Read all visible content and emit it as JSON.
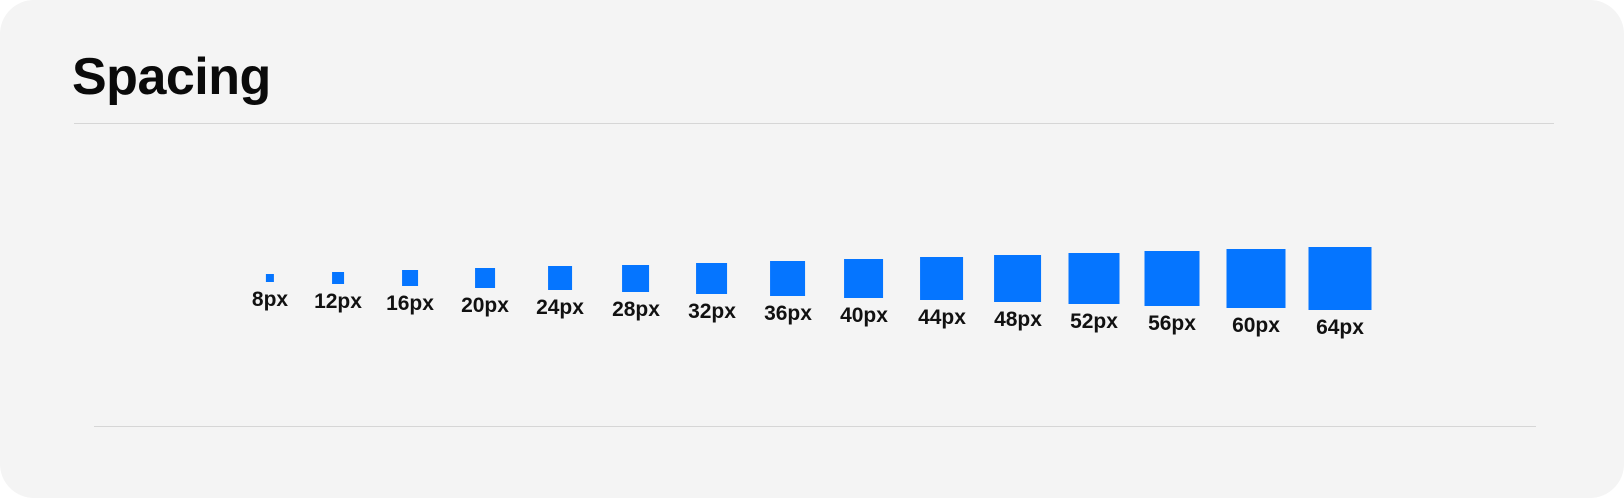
{
  "title": "Spacing",
  "accent_color": "#0575ff",
  "steps": [
    {
      "label": "8px",
      "value": 8
    },
    {
      "label": "12px",
      "value": 12
    },
    {
      "label": "16px",
      "value": 16
    },
    {
      "label": "20px",
      "value": 20
    },
    {
      "label": "24px",
      "value": 24
    },
    {
      "label": "28px",
      "value": 28
    },
    {
      "label": "32px",
      "value": 32
    },
    {
      "label": "36px",
      "value": 36
    },
    {
      "label": "40px",
      "value": 40
    },
    {
      "label": "44px",
      "value": 44
    },
    {
      "label": "48px",
      "value": 48
    },
    {
      "label": "52px",
      "value": 52
    },
    {
      "label": "56px",
      "value": 56
    },
    {
      "label": "60px",
      "value": 60
    },
    {
      "label": "64px",
      "value": 64
    }
  ]
}
